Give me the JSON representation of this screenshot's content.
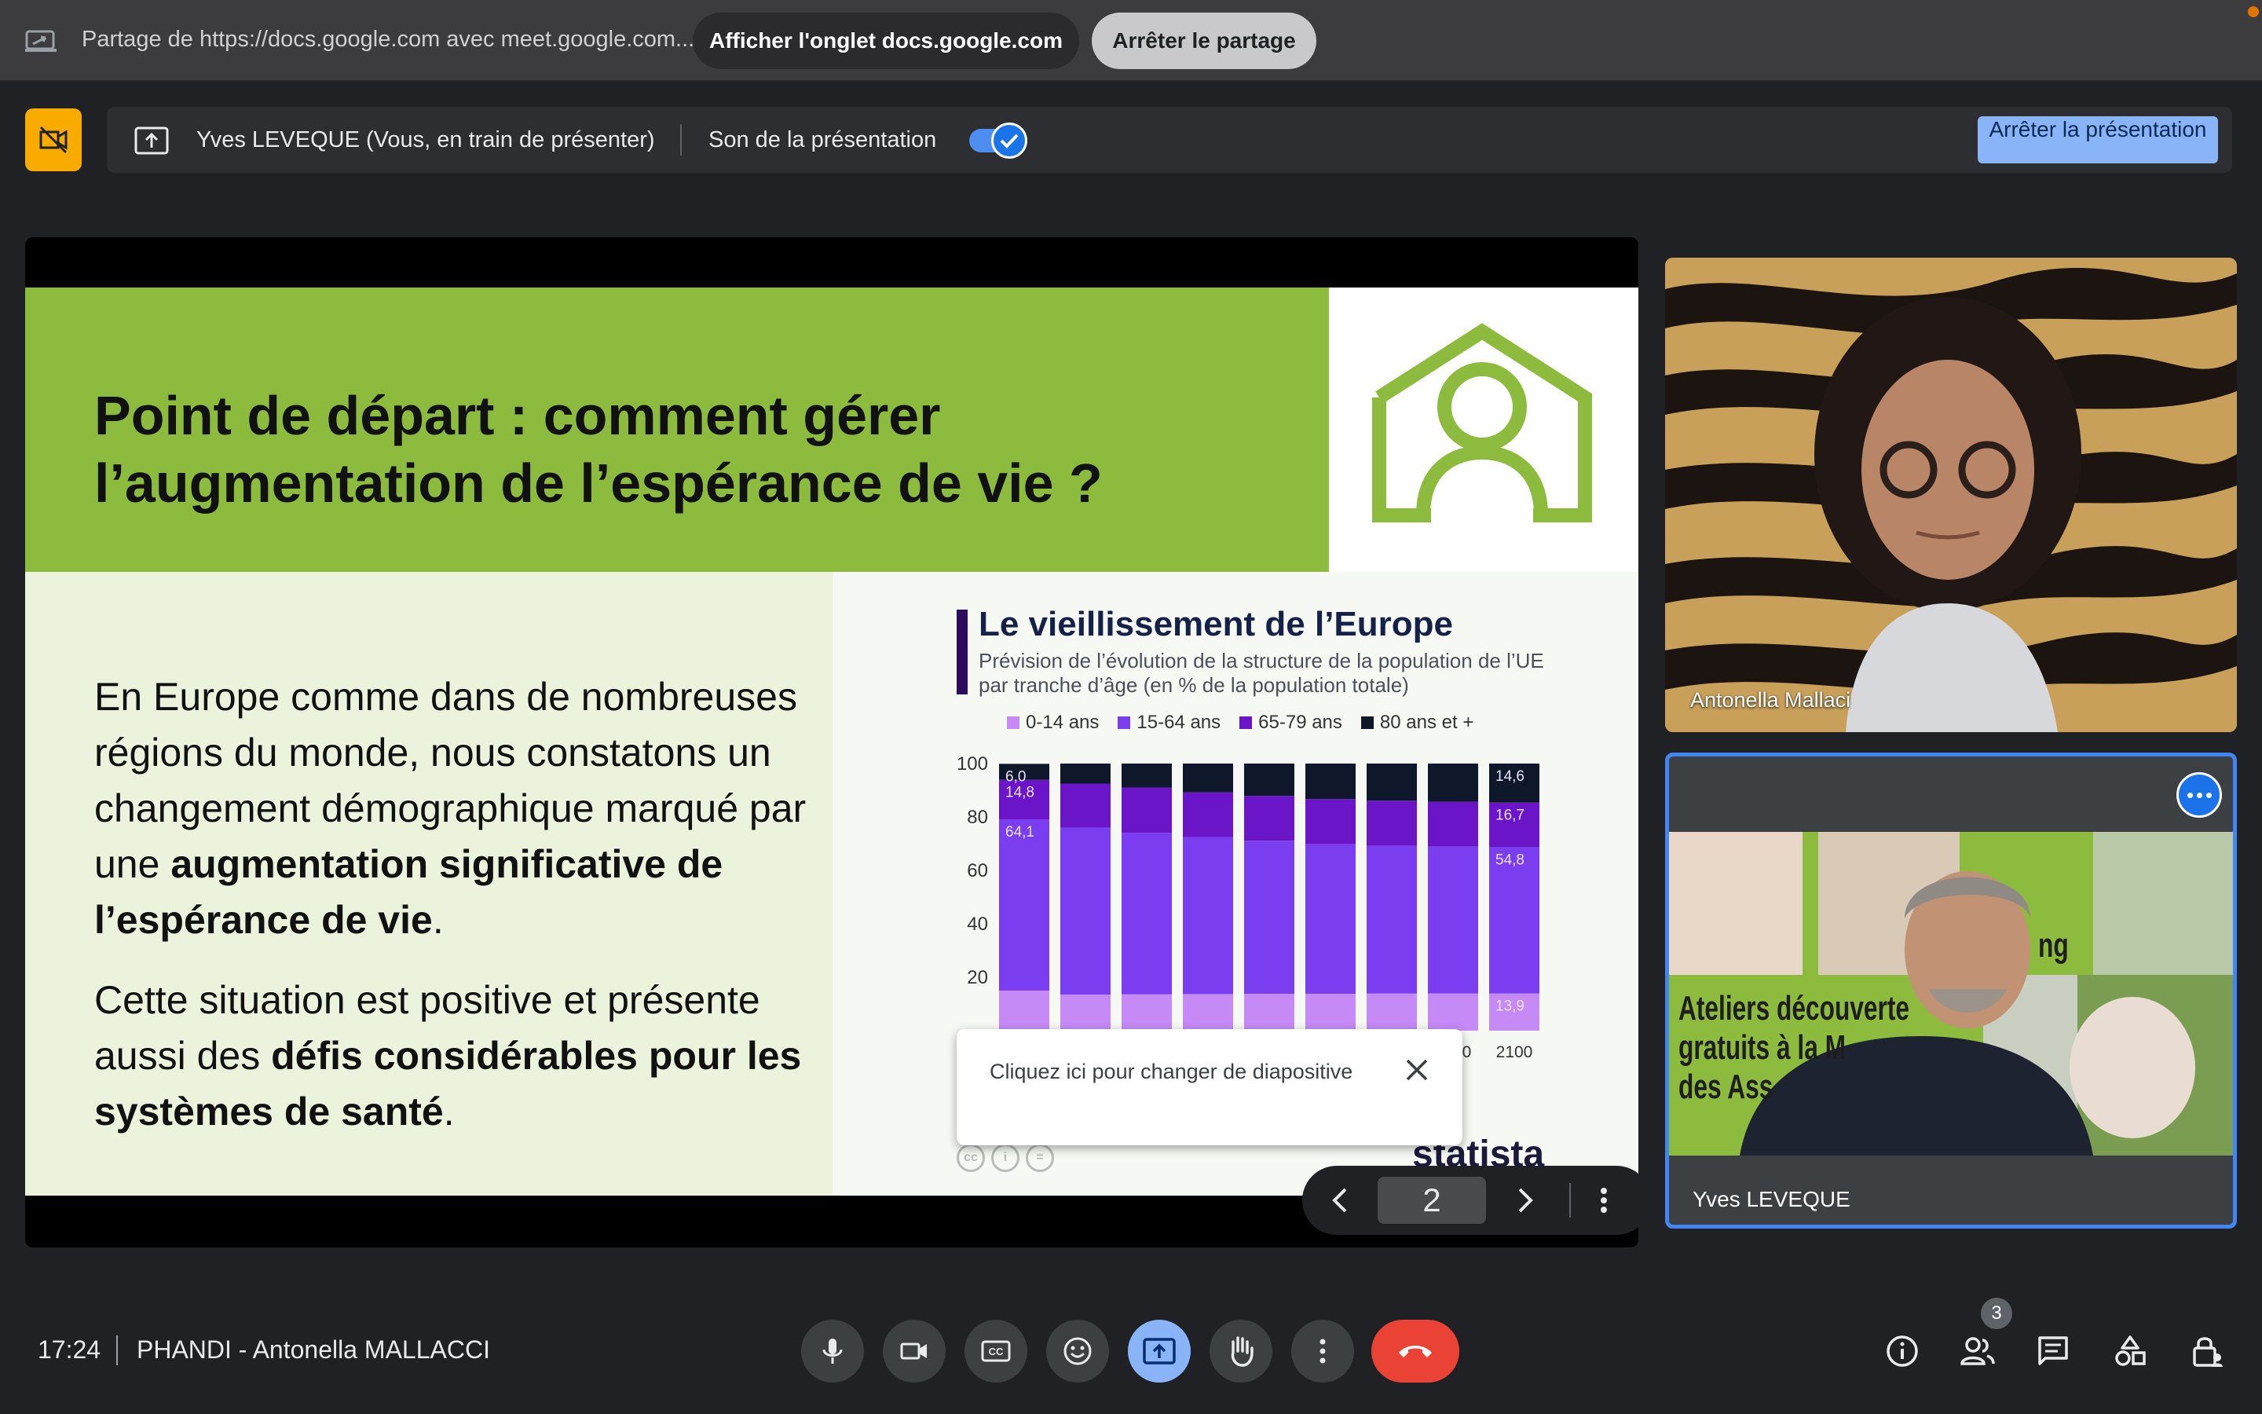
{
  "share_bar": {
    "share_text": "Partage de https://docs.google.com avec meet.google.com...",
    "show_tab_label": "Afficher l'onglet docs.google.com",
    "stop_share_label": "Arrêter le partage"
  },
  "presenter_bar": {
    "presenter_name": "Yves LEVEQUE (Vous, en train de présenter)",
    "audio_label": "Son de la présentation",
    "audio_enabled": true,
    "stop_present_label": "Arrêter la présentation"
  },
  "slide": {
    "title": "Point de départ : comment gérer\nl’augmentation de l’espérance de vie ?",
    "p1_a": "En Europe comme dans de nombreuses régions du monde, nous constatons un changement démographique marqué par une ",
    "p1_b": "augmentation significative de l’espérance de vie",
    "p1_c": ".",
    "p2_a": "Cette situation est positive et présente aussi des ",
    "p2_b": "défis considérables pour les systèmes de santé",
    "p2_c": ".",
    "header_color": "#8dbb3e",
    "page_number": "2",
    "statista": "statista"
  },
  "chart_data": {
    "type": "bar",
    "stacked": true,
    "title": "Le vieillissement de l’Europe",
    "subtitle": "Prévision de l’évolution de la structure de la population de l’UE par tranche d’âge (en % de la population totale)",
    "categories": [
      "",
      "",
      "",
      "",
      "",
      "",
      "",
      "2090",
      "2100"
    ],
    "y_ticks": [
      "100",
      "80",
      "60",
      "40",
      "20"
    ],
    "ylim": [
      0,
      100
    ],
    "series": [
      {
        "name": "0-14 ans",
        "color": "#c58af5",
        "values": [
          15.0,
          13.5,
          13.6,
          13.7,
          13.8,
          13.8,
          13.9,
          13.9,
          13.9
        ],
        "labels": [
          "",
          "",
          "",
          "",
          "",
          "",
          "",
          "",
          "13,9"
        ]
      },
      {
        "name": "15-64 ans",
        "color": "#7a3ef0",
        "values": [
          64.1,
          62.5,
          60.5,
          58.8,
          57.3,
          56.0,
          55.3,
          55.0,
          54.8
        ],
        "labels": [
          "64,1",
          "",
          "",
          "",
          "",
          "",
          "",
          "",
          "54,8"
        ]
      },
      {
        "name": "65-79 ans",
        "color": "#6a16c8",
        "values": [
          14.8,
          16.5,
          16.9,
          16.7,
          16.8,
          16.9,
          16.9,
          16.8,
          16.7
        ],
        "labels": [
          "14,8",
          "",
          "",
          "",
          "",
          "",
          "",
          "",
          "16,7"
        ]
      },
      {
        "name": "80 ans et +",
        "color": "#0f172a",
        "values": [
          6.0,
          7.5,
          9.0,
          10.8,
          12.1,
          13.3,
          13.9,
          14.3,
          14.6
        ],
        "labels": [
          "6,0",
          "",
          "",
          "",
          "",
          "",
          "",
          "",
          "14,6"
        ]
      }
    ]
  },
  "tooltip": {
    "text": "Cliquez ici pour changer de diapositive"
  },
  "participants": [
    {
      "name": "Antonella Mallaci"
    },
    {
      "name": "Yves LEVEQUE",
      "promo_line1": "Ateliers découverte",
      "promo_line2": "gratuits à la M",
      "promo_line3": "des Ass",
      "promo_badge": "ng"
    }
  ],
  "bottom_bar": {
    "time": "17:24",
    "meeting_title": "PHANDI - Antonella MALLACCI",
    "people_count": "3"
  },
  "icons": {
    "share": "tab-share-icon",
    "mic": "microphone-icon",
    "camera": "camera-icon",
    "captions": "captions-icon",
    "emoji": "emoji-icon",
    "present": "present-icon",
    "hand": "raise-hand-icon",
    "more": "more-vert-icon",
    "end": "end-call-icon"
  },
  "colors": {
    "accent": "#8ab4f8",
    "end_call": "#ea4335",
    "active_tile_border": "#4285f4"
  }
}
